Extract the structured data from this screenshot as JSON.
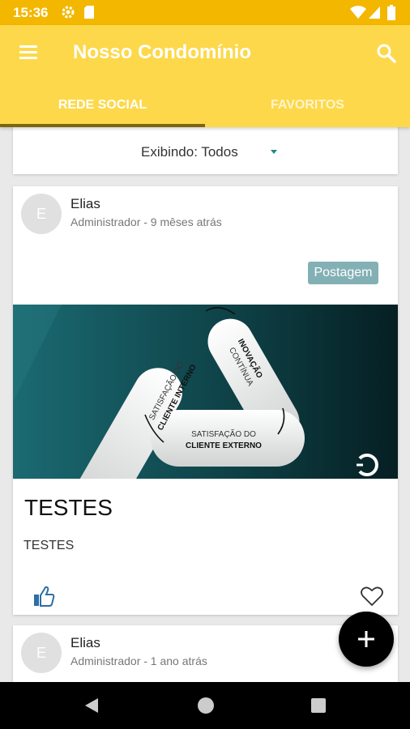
{
  "status_bar": {
    "time": "15:36",
    "icons": [
      "settings-icon",
      "sd-card-icon",
      "wifi-icon",
      "signal-icon",
      "battery-icon"
    ]
  },
  "app_bar": {
    "title": "Nosso Condomínio",
    "menu_icon": "menu-icon",
    "search_icon": "search-icon",
    "color": "#fdd84a"
  },
  "tabs": [
    {
      "label": "REDE SOCIAL",
      "selected": true
    },
    {
      "label": "FAVORITOS",
      "selected": false
    }
  ],
  "filter": {
    "label": "Exibindo: Todos"
  },
  "posts": [
    {
      "avatar_letter": "E",
      "author": "Elias",
      "meta": "Administrador - 9 mêses atrás",
      "badge": "Postagem",
      "image_text": {
        "left_line1": "SATISFAÇÃO DO",
        "left_line2": "CLIENTE INTERNO",
        "right_line1": "INOVAÇÃO",
        "right_line2": "CONTÍNUA",
        "bottom_line1": "SATISFAÇÃO DO",
        "bottom_line2": "CLIENTE EXTERNO"
      },
      "title": "TESTES",
      "body": "TESTES"
    },
    {
      "avatar_letter": "E",
      "author": "Elias",
      "meta": "Administrador - 1 ano atrás"
    }
  ],
  "fab": {
    "icon": "plus-icon"
  },
  "colors": {
    "status_bar": "#f3b700",
    "app_bar": "#fdd84a",
    "tab_indicator": "#7d6412",
    "badge": "#83b0b4",
    "image_bg": "#0f4a4f",
    "fab": "#000000"
  }
}
